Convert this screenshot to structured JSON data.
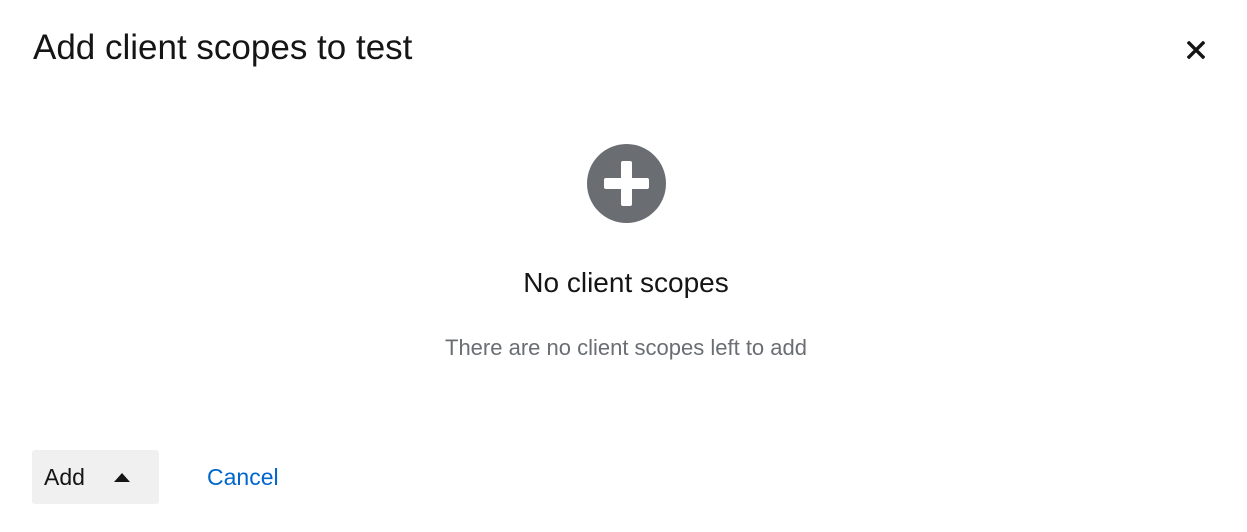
{
  "modal": {
    "title": "Add client scopes to test",
    "close_icon": "close-icon"
  },
  "empty_state": {
    "icon": "plus-circle-icon",
    "icon_color": "#6a6e73",
    "title": "No client scopes",
    "body": "There are no client scopes left to add"
  },
  "footer": {
    "add_label": "Add",
    "add_caret_icon": "caret-up-icon",
    "cancel_label": "Cancel",
    "cancel_color": "#0066cc"
  }
}
